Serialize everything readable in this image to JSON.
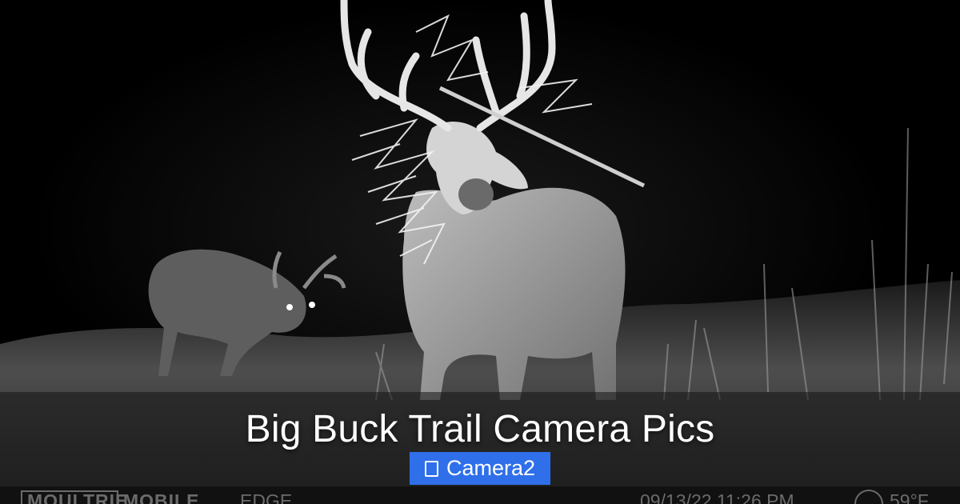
{
  "title": "Big Buck Trail Camera Pics",
  "badge": {
    "icon": "folder-icon",
    "label": "Camera2",
    "color": "#2f6fea"
  },
  "photo": {
    "subject": "night-vision image of bucks",
    "colors": {
      "sky": "#000000",
      "grass": "#7a7a7a",
      "band": "#141414"
    }
  },
  "camera_overlay": {
    "brand": "MOULTRIE",
    "product": "MOBILE",
    "model": "EDGE",
    "datetime": "09/13/22 11:26 PM",
    "temperature": "59°F",
    "moon_icon": "moon-icon"
  }
}
